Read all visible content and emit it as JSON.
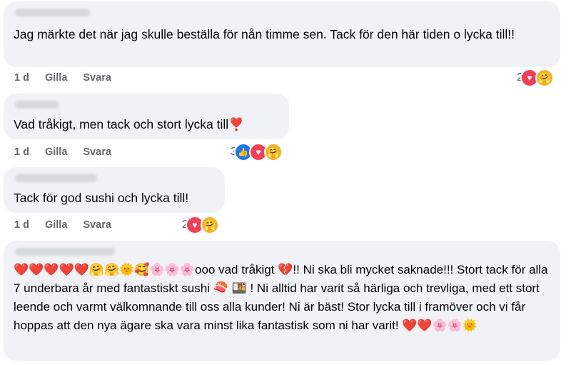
{
  "comments": [
    {
      "text": "Jag märkte det när jag skulle beställa för nån timme sen. Tack för den här tiden o lycka till!!",
      "time": "1 d",
      "like": "Gilla",
      "reply": "Svara",
      "reaction_count": "2",
      "reaction_icons": [
        "love-icon",
        "care-icon"
      ]
    },
    {
      "text": "Vad tråkigt, men tack och stort lycka till❣️",
      "time": "1 d",
      "like": "Gilla",
      "reply": "Svara",
      "reaction_count": "3",
      "reaction_icons": [
        "like-icon",
        "love-icon",
        "care-icon"
      ]
    },
    {
      "text": "Tack för god sushi och lycka till!",
      "time": "1 d",
      "like": "Gilla",
      "reply": "Svara",
      "reaction_count": "2",
      "reaction_icons": [
        "love-icon",
        "care-icon"
      ]
    },
    {
      "text": "❤️❤️❤️❤️❤️🤗🤗🌞🥰🌸🌸🌸ooo vad tråkigt 💔!! Ni ska bli mycket saknade!!! Stort tack för alla 7 underbara år med fantastiskt sushi 🍣 🍱 ! Ni alltid har varit så härliga och trevliga, med ett stort leende och varmt välkomnande till oss alla kunder! Ni är bäst! Stor lycka till i framöver och vi får hoppas att den nya ägare ska vara minst lika fantastisk som ni har varit! ❤️❤️🌸🌸🌞"
    }
  ]
}
